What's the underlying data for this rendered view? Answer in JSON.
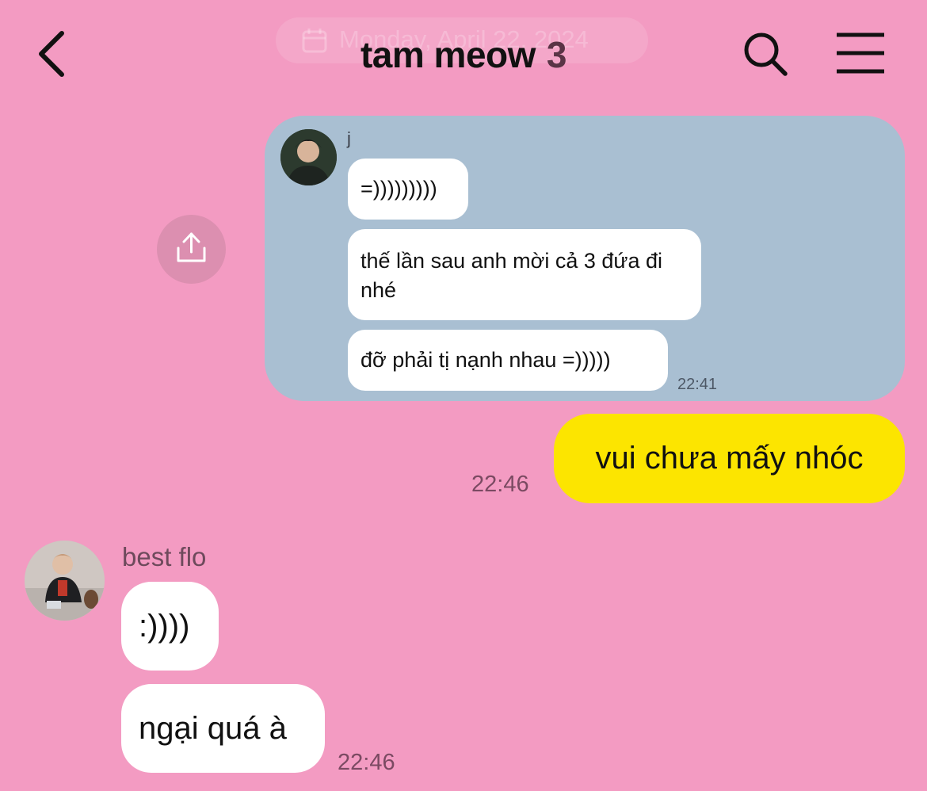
{
  "header": {
    "title": "tam meow",
    "member_count": "3",
    "date_overlay": "Monday, April 22, 2024",
    "icons": {
      "back": "chevron-left-icon",
      "search": "search-icon",
      "menu": "hamburger-menu-icon",
      "calendar": "calendar-icon"
    }
  },
  "forwarded": {
    "sender": "j",
    "messages": [
      "=)))))))))",
      "thế lần sau anh mời cả 3 đứa đi nhé",
      "đỡ phải tị nạnh nhau =)))))"
    ],
    "time": "22:41",
    "colors": {
      "card": "#a9bfd2"
    }
  },
  "own_message": {
    "text": "vui chưa mấy nhóc",
    "time": "22:46",
    "color": "#fce500"
  },
  "received": {
    "sender": "best flo",
    "messages": [
      ":))))",
      "ngại quá à"
    ],
    "time": "22:46"
  },
  "colors": {
    "background": "#f39bc2"
  }
}
